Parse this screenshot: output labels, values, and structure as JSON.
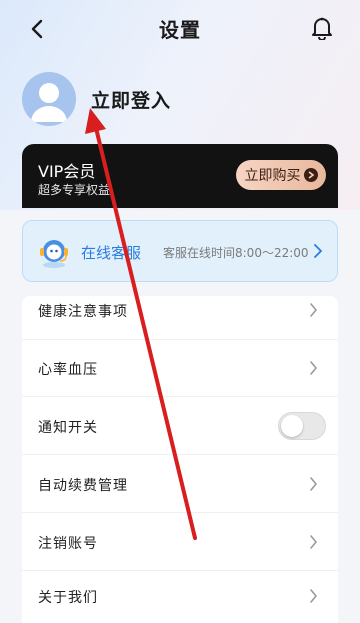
{
  "header": {
    "title": "设置",
    "back_icon": "chevron-left-icon",
    "bell_icon": "bell-icon"
  },
  "profile": {
    "login_text": "立即登入",
    "avatar_icon": "user-avatar-icon"
  },
  "vip": {
    "title": "VIP会员",
    "subtitle": "超多专享权益",
    "buy_label": "立即购买"
  },
  "service": {
    "label": "在线客服",
    "hours": "客服在线时间8:00～22:00",
    "icon": "customer-service-icon"
  },
  "menu": {
    "items": [
      {
        "label": "健康注意事项"
      },
      {
        "label": "心率血压"
      },
      {
        "label": "通知开关"
      },
      {
        "label": "自动续费管理"
      },
      {
        "label": "注销账号"
      },
      {
        "label": "关于我们"
      }
    ]
  },
  "toggle": {
    "enabled": false
  },
  "colors": {
    "accent": "#2a7de0",
    "annotation_arrow": "#d81e1e",
    "vip_card": "#121212"
  }
}
